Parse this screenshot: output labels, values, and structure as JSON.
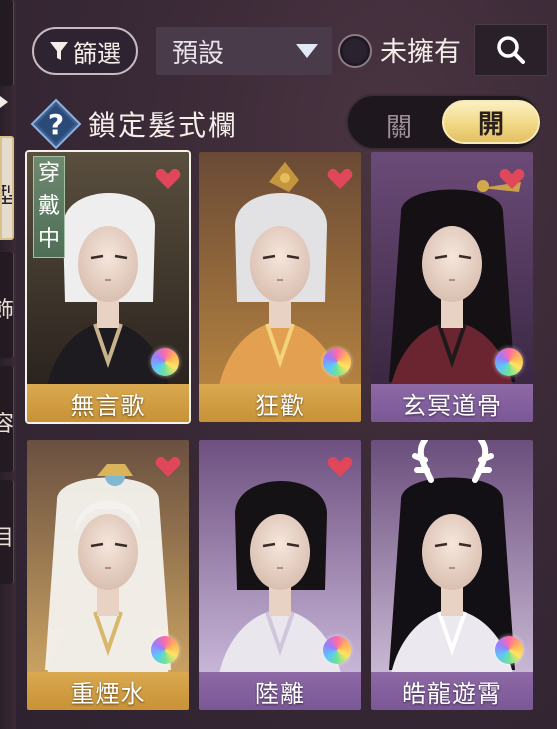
{
  "side_tabs": [
    {
      "glyph": "",
      "active": false
    },
    {
      "glyph": "型",
      "active": true
    },
    {
      "glyph": "飾",
      "active": false
    },
    {
      "glyph": "容",
      "active": false
    },
    {
      "glyph": "目",
      "active": false
    }
  ],
  "toolbar": {
    "filter_label": "篩選",
    "preset_value": "預設",
    "unowned_label": "未擁有",
    "search_icon": "search-icon",
    "filter_icon": "funnel-icon"
  },
  "lock_row": {
    "help_icon": "question-diamond-icon",
    "label": "鎖定髮式欄",
    "toggle_off": "關",
    "toggle_on": "開",
    "toggle_state": "on"
  },
  "badge": {
    "wearing": [
      "穿",
      "戴",
      "中"
    ]
  },
  "cards": [
    {
      "name": "無言歌",
      "tier": "gold",
      "selected": true,
      "wearing": true,
      "heart": true,
      "orb": true,
      "hair": "#eeeeee",
      "bg1": "#5a4f3e",
      "bg2": "#2a231e"
    },
    {
      "name": "狂歡",
      "tier": "gold",
      "selected": false,
      "wearing": false,
      "heart": true,
      "orb": true,
      "hair": "#e2e2e4",
      "bg1": "#6a4a36",
      "bg2": "#b48240"
    },
    {
      "name": "玄冥道骨",
      "tier": "purple",
      "selected": false,
      "wearing": false,
      "heart": true,
      "orb": true,
      "hair": "#141014",
      "bg1": "#6b4b78",
      "bg2": "#3a2742"
    },
    {
      "name": "重煙水",
      "tier": "gold",
      "selected": false,
      "wearing": false,
      "heart": true,
      "orb": true,
      "hair": "#f4f2ee",
      "bg1": "#6a5040",
      "bg2": "#c9a262"
    },
    {
      "name": "陸離",
      "tier": "purple",
      "selected": false,
      "wearing": false,
      "heart": true,
      "orb": true,
      "hair": "#151215",
      "bg1": "#6e5080",
      "bg2": "#c8b6d8"
    },
    {
      "name": "皓龍遊霄",
      "tier": "purple",
      "selected": false,
      "wearing": false,
      "heart": false,
      "orb": true,
      "hair": "#121014",
      "bg1": "#6a4e7c",
      "bg2": "#c9b8d4"
    }
  ],
  "colors": {
    "gold_bar": "#d2a046",
    "purple_bar": "#8462a0",
    "heart": "#e0475b",
    "toggle_gold": "#f0d680"
  }
}
